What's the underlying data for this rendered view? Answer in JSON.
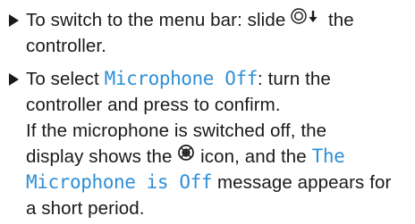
{
  "instructions": [
    {
      "line1_text": "To switch to the menu bar: slide",
      "line1_after_icon": "the",
      "line2_text": "controller.",
      "controller_icon": "controller-slide-down-icon"
    },
    {
      "line1_text": "To select",
      "line1_term": "Microphone Off",
      "line1_after": ": turn the",
      "line2_text": "controller and press to confirm.",
      "line3_text": "If the microphone is switched off, the",
      "line4_before": "display shows the",
      "line4_icon": "microphone-off-icon",
      "line4_after": "icon, and the",
      "line4_term": "The",
      "line5_term": "Microphone is Off",
      "line5_after": "message appears for",
      "line6_text": "a short period."
    }
  ],
  "colors": {
    "text": "#1a1a1a",
    "highlight": "#2f8fd6"
  }
}
